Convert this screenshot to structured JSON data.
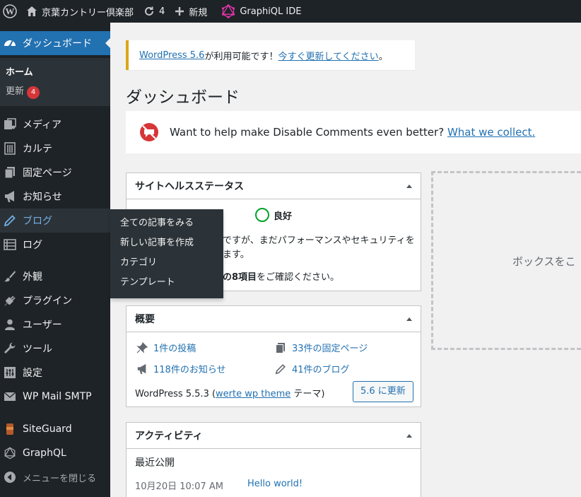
{
  "adminbar": {
    "site_name": "京葉カントリー倶楽部",
    "updates_count": "4",
    "new_label": "新規",
    "graphiql_label": "GraphiQL IDE"
  },
  "sidebar": {
    "dashboard": "ダッシュボード",
    "home": "ホーム",
    "updates": "更新",
    "updates_badge": "4",
    "items": [
      {
        "label": "メディア",
        "icon": "media-icon"
      },
      {
        "label": "カルテ",
        "icon": "building-icon"
      },
      {
        "label": "固定ページ",
        "icon": "pages-icon"
      },
      {
        "label": "お知らせ",
        "icon": "megaphone-icon"
      },
      {
        "label": "ブログ",
        "icon": "pencil-icon"
      },
      {
        "label": "ログ",
        "icon": "list-icon"
      },
      {
        "label": "外観",
        "icon": "brush-icon"
      },
      {
        "label": "プラグイン",
        "icon": "plugin-icon"
      },
      {
        "label": "ユーザー",
        "icon": "user-icon"
      },
      {
        "label": "ツール",
        "icon": "wrench-icon"
      },
      {
        "label": "設定",
        "icon": "settings-icon"
      },
      {
        "label": "WP Mail SMTP",
        "icon": "mail-icon"
      },
      {
        "label": "SiteGuard",
        "icon": "siteguard-icon"
      },
      {
        "label": "GraphQL",
        "icon": "graphql-icon"
      }
    ],
    "collapse": "メニューを閉じる"
  },
  "flyout": {
    "items": [
      "全ての記事をみる",
      "新しい記事を作成",
      "カテゴリ",
      "テンプレート"
    ]
  },
  "main": {
    "update_notice": {
      "link1": "WordPress 5.6",
      "middle": " が利用可能です！",
      "link2": "今すぐ更新してください",
      "end": "。"
    },
    "title": "ダッシュボード",
    "dc_notice": {
      "text": "Want to help make Disable Comments even better?",
      "link": "What we collect."
    },
    "health": {
      "title": "サイトヘルスステータス",
      "status": "良好",
      "line1": "ですが、まだパフォーマンスやセキュリティを",
      "line2": "ます。",
      "line3_bold": "の8項目",
      "line3_rest": "をご確認ください。"
    },
    "glance": {
      "title": "概要",
      "posts": "1件の投稿",
      "pages": "33件の固定ページ",
      "news": "118件のお知らせ",
      "blogs": "41件のブログ",
      "wp_version_prefix": "WordPress 5.5.3 (",
      "theme_link": "werte wp theme",
      "wp_version_suffix": " テーマ)",
      "update_button": "5.6 に更新"
    },
    "activity": {
      "title": "アクティビティ",
      "recent": "最近公開",
      "date": "10月20日 10:07 AM",
      "post_link": "Hello world!"
    },
    "dropzone": "ボックスをこ"
  },
  "colors": {
    "adminbar_bg": "#1d2327",
    "accent": "#2271b1",
    "badge": "#d63638",
    "notice_warning": "#dba617",
    "health_good": "#00a32a"
  }
}
